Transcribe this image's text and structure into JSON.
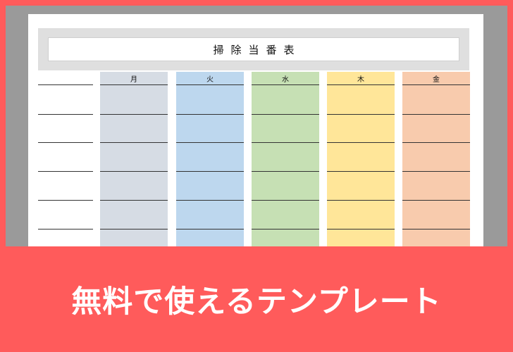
{
  "sheet": {
    "title": "掃除当番表",
    "days": [
      {
        "label": "月",
        "color": "#d6dce4"
      },
      {
        "label": "火",
        "color": "#bdd7ee"
      },
      {
        "label": "水",
        "color": "#c6e0b4"
      },
      {
        "label": "木",
        "color": "#ffe699"
      },
      {
        "label": "金",
        "color": "#f8cbad"
      }
    ]
  },
  "banner": {
    "text": "無料で使えるテンプレート"
  }
}
